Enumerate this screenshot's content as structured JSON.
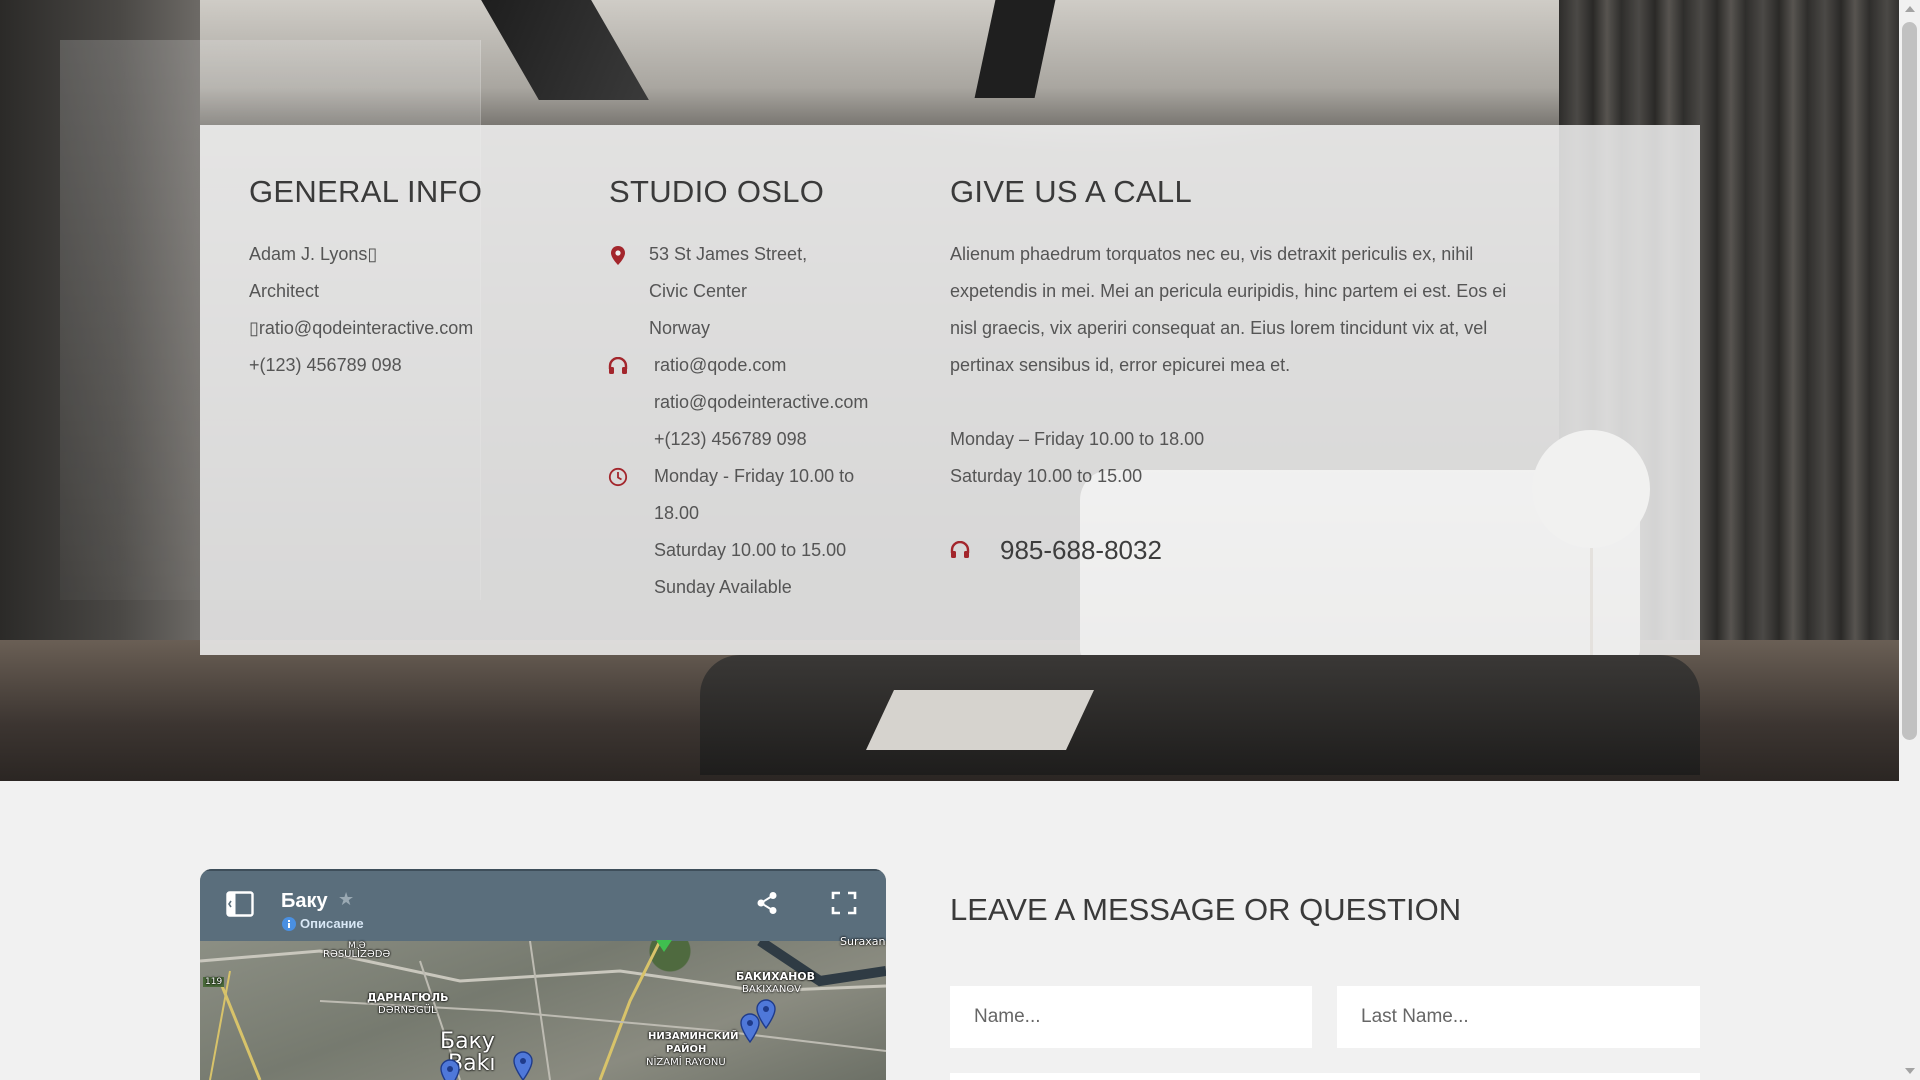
{
  "colors": {
    "accent": "#a3262c",
    "panel": "#f0f0f0",
    "page_bg": "#f1f1f1",
    "map_header": "#5a6e7c"
  },
  "general_info": {
    "title": "GENERAL INFO",
    "name": "Adam J. Lyons▯",
    "role": "Architect",
    "email": "▯ratio@qodeinteractive.com",
    "phone": "+(123) 456789 098"
  },
  "studio": {
    "title": "STUDIO OSLO",
    "address": [
      "53 St James Street,",
      "Civic Center",
      "Norway"
    ],
    "contacts": [
      "ratio@qode.com",
      "ratio@qodeinteractive.com",
      "+(123) 456789 098"
    ],
    "hours": [
      "Monday - Friday 10.00 to",
      "18.00",
      "Saturday 10.00 to 15.00",
      "Sunday Available"
    ],
    "icons": [
      "map-pin-icon",
      "headphones-icon",
      "clock-icon"
    ]
  },
  "call": {
    "title": "GIVE US A CALL",
    "text": [
      "Alienum phaedrum torquatos nec eu, vis detraxit periculis ex, nihil",
      "expetendis in mei. Mei an pericula euripidis, hinc partem ei est. Eos ei",
      "nisl graecis, vix aperiri consequat an. Eius lorem tincidunt vix at, vel",
      "pertinax sensibus id, error epicurei mea et."
    ],
    "hours": [
      "Monday – Friday 10.00 to 18.00",
      "Saturday 10.00 to 15.00"
    ],
    "phone": "985-688-8032",
    "icon": "headphones-icon"
  },
  "map": {
    "title": "Баку",
    "description": "Описание",
    "labels": {
      "r_top": "M.Ə",
      "r_top2": "RƏSULİZƏDƏ",
      "d1": "ДАРНАГЮЛЬ",
      "d2": "DƏRNƏGÜL",
      "b1": "БАКИХАНОВ",
      "b2": "BAKIXANOV",
      "n1": "НИЗАМИНСКИЙ",
      "n2": "РАЙОН",
      "n3": "NİZAMİ RAYONU",
      "city1": "Баку",
      "city2": "Bakı",
      "road": "119",
      "corner": "Suraxan"
    }
  },
  "form": {
    "title": "LEAVE A MESSAGE OR QUESTION",
    "name_placeholder": "Name...",
    "last_name_placeholder": "Last Name..."
  }
}
